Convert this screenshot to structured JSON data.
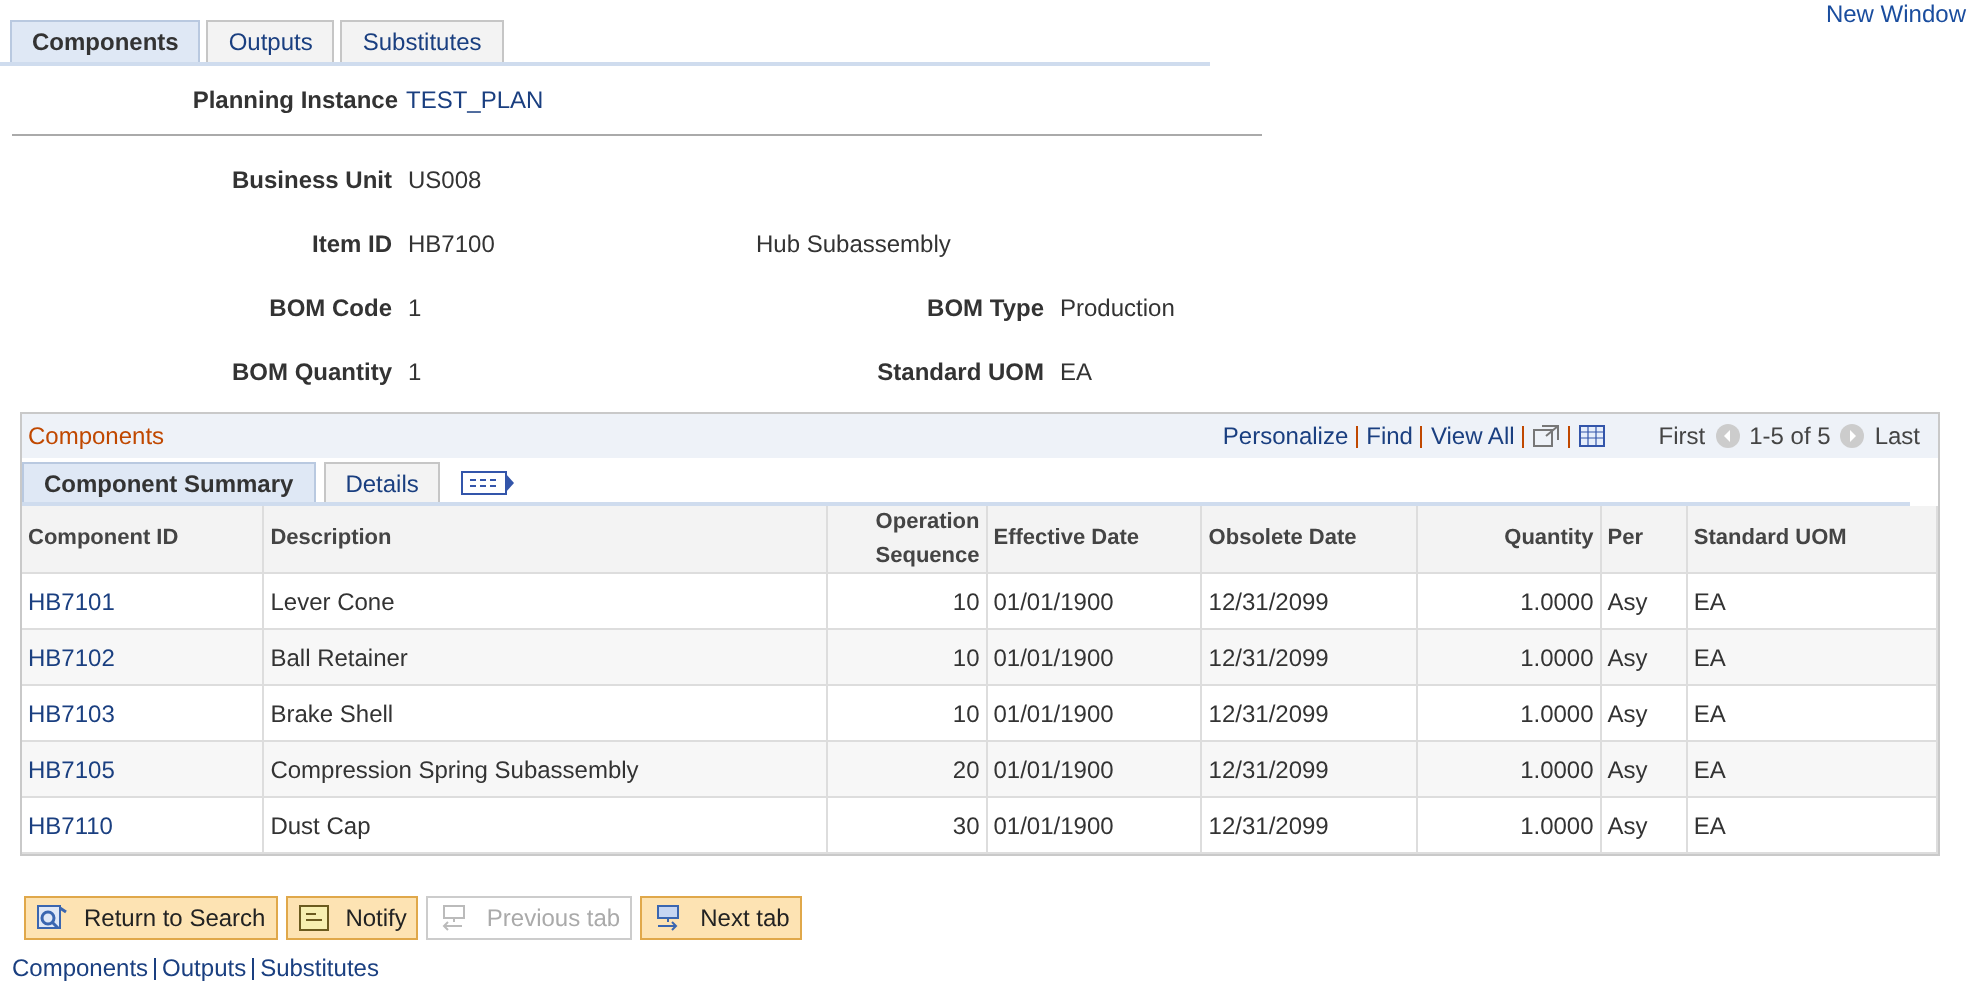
{
  "top_link": "New Window",
  "tabs": [
    {
      "label": "Components",
      "selected": true
    },
    {
      "label": "Outputs",
      "selected": false
    },
    {
      "label": "Substitutes",
      "selected": false
    }
  ],
  "planning_instance": {
    "label": "Planning Instance",
    "value": "TEST_PLAN"
  },
  "fields": [
    {
      "label": "Business Unit",
      "value": "US008"
    },
    {
      "label": "Item ID",
      "value": "HB7100",
      "extra": "Hub Subassembly"
    },
    {
      "label": "BOM Code",
      "value": "1",
      "label2": "BOM Type",
      "value2": "Production"
    },
    {
      "label": "BOM Quantity",
      "value": "1",
      "label2": "Standard UOM",
      "value2": "EA"
    }
  ],
  "grid": {
    "title": "Components",
    "links": [
      "Personalize",
      "Find",
      "View All"
    ],
    "first": "First",
    "range": "1-5 of 5",
    "last": "Last",
    "tabs": [
      {
        "label": "Component Summary",
        "selected": true
      },
      {
        "label": "Details",
        "selected": false
      }
    ],
    "columns": [
      "Component ID",
      "Description",
      "Operation Sequence",
      "Effective Date",
      "Obsolete Date",
      "Quantity",
      "Per",
      "Standard UOM"
    ],
    "rows": [
      [
        "HB7101",
        "Lever Cone",
        "10",
        "01/01/1900",
        "12/31/2099",
        "1.0000",
        "Asy",
        "EA"
      ],
      [
        "HB7102",
        "Ball Retainer",
        "10",
        "01/01/1900",
        "12/31/2099",
        "1.0000",
        "Asy",
        "EA"
      ],
      [
        "HB7103",
        "Brake Shell",
        "10",
        "01/01/1900",
        "12/31/2099",
        "1.0000",
        "Asy",
        "EA"
      ],
      [
        "HB7105",
        "Compression Spring Subassembly",
        "20",
        "01/01/1900",
        "12/31/2099",
        "1.0000",
        "Asy",
        "EA"
      ],
      [
        "HB7110",
        "Dust Cap",
        "30",
        "01/01/1900",
        "12/31/2099",
        "1.0000",
        "Asy",
        "EA"
      ]
    ]
  },
  "buttons": [
    {
      "label": "Return to Search",
      "kind": "search",
      "disabled": false
    },
    {
      "label": "Notify",
      "kind": "notify",
      "disabled": false
    },
    {
      "label": "Previous tab",
      "kind": "prev",
      "disabled": true
    },
    {
      "label": "Next tab",
      "kind": "next",
      "disabled": false
    }
  ],
  "footer_links": [
    "Components",
    "Outputs",
    "Substitutes"
  ]
}
